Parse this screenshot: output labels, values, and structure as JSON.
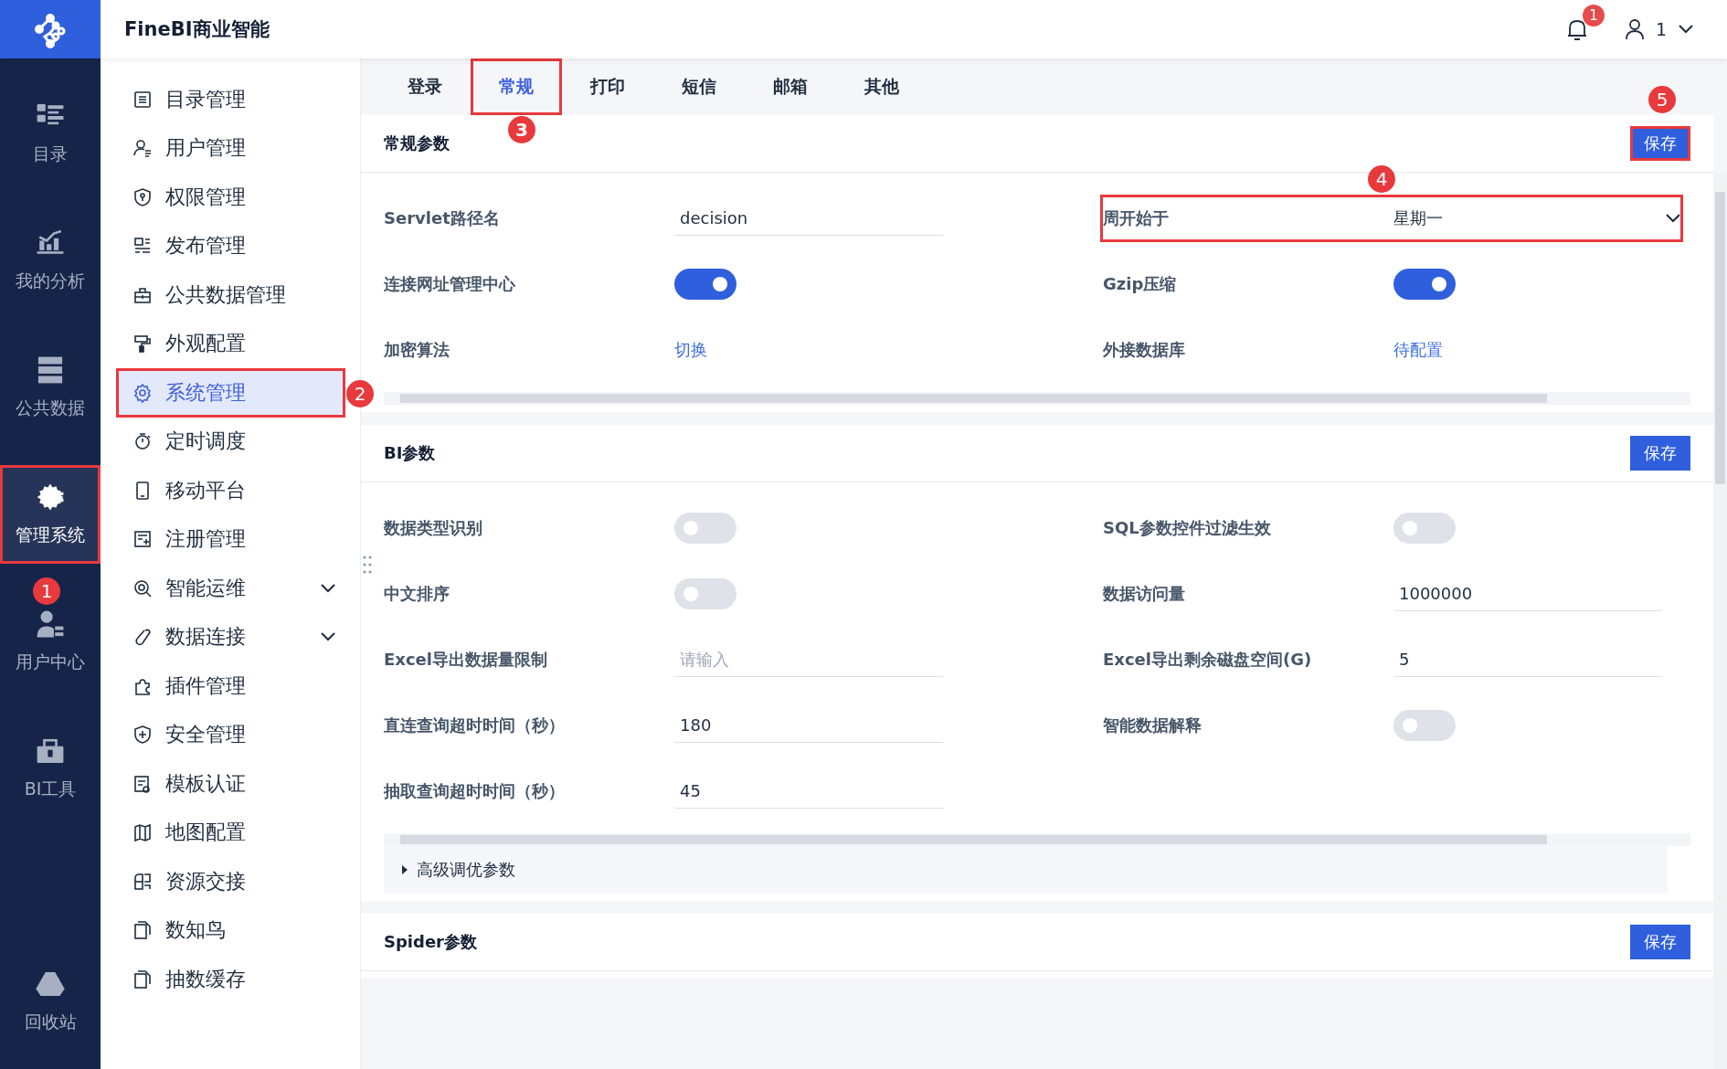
{
  "app": {
    "title": "FineBI商业智能"
  },
  "header": {
    "notification_count": "1",
    "user": "1"
  },
  "rail": [
    {
      "label": "目录",
      "selected": false
    },
    {
      "label": "我的分析",
      "selected": false
    },
    {
      "label": "公共数据",
      "selected": false
    },
    {
      "label": "管理系统",
      "selected": true,
      "highlighted": true,
      "callout": "1"
    },
    {
      "label": "用户中心",
      "selected": false
    },
    {
      "label": "BI工具",
      "selected": false
    },
    {
      "label": "回收站",
      "selected": false
    }
  ],
  "menu": [
    {
      "label": "目录管理",
      "selected": false,
      "expandable": false
    },
    {
      "label": "用户管理",
      "selected": false,
      "expandable": false
    },
    {
      "label": "权限管理",
      "selected": false,
      "expandable": false
    },
    {
      "label": "发布管理",
      "selected": false,
      "expandable": false
    },
    {
      "label": "公共数据管理",
      "selected": false,
      "expandable": false
    },
    {
      "label": "外观配置",
      "selected": false,
      "expandable": false
    },
    {
      "label": "系统管理",
      "selected": true,
      "expandable": false,
      "highlighted": true,
      "callout": "2"
    },
    {
      "label": "定时调度",
      "selected": false,
      "expandable": false
    },
    {
      "label": "移动平台",
      "selected": false,
      "expandable": false
    },
    {
      "label": "注册管理",
      "selected": false,
      "expandable": false
    },
    {
      "label": "智能运维",
      "selected": false,
      "expandable": true
    },
    {
      "label": "数据连接",
      "selected": false,
      "expandable": true
    },
    {
      "label": "插件管理",
      "selected": false,
      "expandable": false
    },
    {
      "label": "安全管理",
      "selected": false,
      "expandable": false
    },
    {
      "label": "模板认证",
      "selected": false,
      "expandable": false
    },
    {
      "label": "地图配置",
      "selected": false,
      "expandable": false
    },
    {
      "label": "资源交接",
      "selected": false,
      "expandable": false
    },
    {
      "label": "数知鸟",
      "selected": false,
      "expandable": false
    },
    {
      "label": "抽数缓存",
      "selected": false,
      "expandable": false
    }
  ],
  "tabs": [
    {
      "label": "登录",
      "selected": false
    },
    {
      "label": "常规",
      "selected": true,
      "highlighted": true,
      "callout": "3"
    },
    {
      "label": "打印",
      "selected": false
    },
    {
      "label": "短信",
      "selected": false
    },
    {
      "label": "邮箱",
      "selected": false
    },
    {
      "label": "其他",
      "selected": false
    }
  ],
  "sections": [
    {
      "title": "常规参数",
      "save": "保存",
      "highlighted": true,
      "callout": "5",
      "columns": [
        [
          {
            "kind": "input",
            "label": "Servlet路径名",
            "value": "decision"
          },
          {
            "kind": "toggle",
            "label": "连接网址管理中心",
            "on": true
          },
          {
            "kind": "link",
            "label": "加密算法",
            "value": "切换"
          }
        ],
        [
          {
            "kind": "select",
            "label": "周开始于",
            "value": "星期一",
            "highlighted": true,
            "callout": "4"
          },
          {
            "kind": "toggle",
            "label": "Gzip压缩",
            "on": true
          },
          {
            "kind": "link",
            "label": "外接数据库",
            "value": "待配置"
          }
        ]
      ]
    },
    {
      "title": "BI参数",
      "save": "保存",
      "highlighted": false,
      "advanced": "高级调优参数",
      "columns": [
        [
          {
            "kind": "toggle",
            "label": "数据类型识别",
            "on": false
          },
          {
            "kind": "toggle",
            "label": "中文排序",
            "on": false
          },
          {
            "kind": "input",
            "label": "Excel导出数据量限制",
            "placeholder": "请输入"
          },
          {
            "kind": "input",
            "label": "直连查询超时时间（秒）",
            "value": "180"
          },
          {
            "kind": "input",
            "label": "抽取查询超时时间（秒）",
            "value": "45"
          }
        ],
        [
          {
            "kind": "toggle",
            "label": "SQL参数控件过滤生效",
            "on": false
          },
          {
            "kind": "input",
            "label": "数据访问量",
            "value": "1000000"
          },
          {
            "kind": "input",
            "label": "Excel导出剩余磁盘空间(G)",
            "value": "5"
          },
          {
            "kind": "toggle",
            "label": "智能数据解释",
            "on": false
          }
        ]
      ]
    },
    {
      "title": "Spider参数",
      "save": "保存",
      "highlighted": false
    }
  ]
}
